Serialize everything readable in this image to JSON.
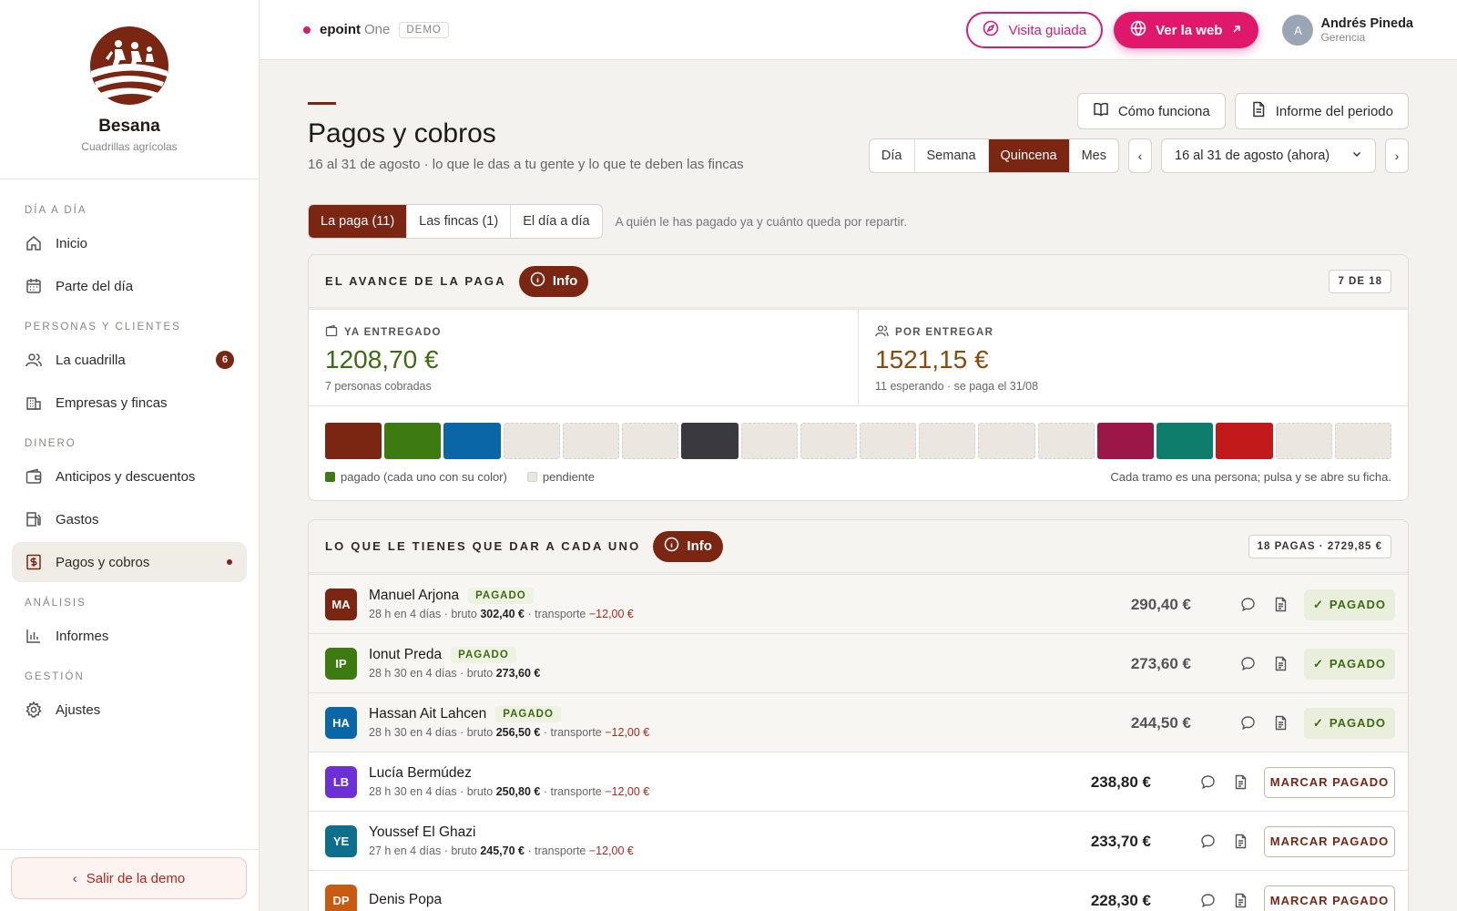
{
  "sidebar": {
    "brand_name": "Besana",
    "brand_sub": "Cuadrillas agrícolas",
    "sections": [
      {
        "title": "DÍA A DÍA"
      },
      {
        "title": "PERSONAS Y CLIENTES"
      },
      {
        "title": "DINERO"
      },
      {
        "title": "ANÁLISIS"
      },
      {
        "title": "GESTIÓN"
      }
    ],
    "items": {
      "inicio": "Inicio",
      "parte": "Parte del día",
      "cuadrilla": "La cuadrilla",
      "cuadrilla_badge": "6",
      "empresas": "Empresas y fincas",
      "anticipos": "Anticipos y descuentos",
      "gastos": "Gastos",
      "pagos": "Pagos y cobros",
      "informes": "Informes",
      "ajustes": "Ajustes"
    },
    "exit_label": "Salir de la demo"
  },
  "topbar": {
    "app_name": "epoint",
    "app_suffix": "One",
    "demo_tag": "DEMO",
    "guided_tour": "Visita guiada",
    "view_web": "Ver la web",
    "user_initial": "A",
    "user_name": "Andrés Pineda",
    "user_role": "Gerencia"
  },
  "header": {
    "title": "Pagos y cobros",
    "subtitle": "16 al 31 de agosto · lo que le das a tu gente y lo que te deben las fincas",
    "how_it_works": "Cómo funciona",
    "period_report": "Informe del periodo",
    "period_options": [
      "Día",
      "Semana",
      "Quincena",
      "Mes"
    ],
    "period_selected": "Quincena",
    "period_value": "16 al 31 de agosto (ahora)"
  },
  "tabs": {
    "items": [
      "La paga (11)",
      "Las fincas (1)",
      "El día a día"
    ],
    "active": "La paga (11)",
    "hint": "A quién le has pagado ya y cuánto queda por repartir."
  },
  "progress_card": {
    "title": "EL AVANCE DE LA PAGA",
    "info": "Info",
    "tag": "7 DE 18",
    "delivered_label": "YA ENTREGADO",
    "delivered_value": "1208,70 €",
    "delivered_note": "7 personas cobradas",
    "pending_label": "POR ENTREGAR",
    "pending_value": "1521,15 €",
    "pending_note": "11 esperando · se paga el 31/08",
    "segments": [
      "#7a2613",
      "#3d7a12",
      "#0b66a8",
      "pend",
      "pend",
      "pend",
      "#3a3940",
      "pend",
      "pend",
      "pend",
      "pend",
      "pend",
      "pend",
      "#9c1648",
      "#0f7d6c",
      "#c21a1a",
      "pend",
      "pend"
    ],
    "legend_paid": "pagado (cada uno con su color)",
    "legend_pending": "pendiente",
    "legend_hint": "Cada tramo es una persona; pulsa y se abre su ficha."
  },
  "pay_card": {
    "title": "LO QUE LE TIENES QUE DAR A CADA UNO",
    "info": "Info",
    "tag": "18 PAGAS · 2729,85 €",
    "paid_label": "PAGADO",
    "mark_label": "MARCAR PAGADO",
    "rows": [
      {
        "initials": "MA",
        "color": "#7a2613",
        "name": "Manuel Arjona",
        "paid": true,
        "hours": "28 h en 4 días · bruto ",
        "gross": "302,40 €",
        "transport_label": " · transporte ",
        "transport": "−12,00 €",
        "amount": "290,40 €"
      },
      {
        "initials": "IP",
        "color": "#3d7a12",
        "name": "Ionut Preda",
        "paid": true,
        "hours": "28 h 30 en 4 días · bruto ",
        "gross": "273,60 €",
        "transport_label": "",
        "transport": "",
        "amount": "273,60 €"
      },
      {
        "initials": "HA",
        "color": "#0b66a8",
        "name": "Hassan Ait Lahcen",
        "paid": true,
        "hours": "28 h 30 en 4 días · bruto ",
        "gross": "256,50 €",
        "transport_label": " · transporte ",
        "transport": "−12,00 €",
        "amount": "244,50 €"
      },
      {
        "initials": "LB",
        "color": "#6d2fd6",
        "name": "Lucía Bermúdez",
        "paid": false,
        "hours": "28 h 30 en 4 días · bruto ",
        "gross": "250,80 €",
        "transport_label": " · transporte ",
        "transport": "−12,00 €",
        "amount": "238,80 €"
      },
      {
        "initials": "YE",
        "color": "#0e6f8c",
        "name": "Youssef El Ghazi",
        "paid": false,
        "hours": "27 h en 4 días · bruto ",
        "gross": "245,70 €",
        "transport_label": " · transporte ",
        "transport": "−12,00 €",
        "amount": "233,70 €"
      },
      {
        "initials": "DP",
        "color": "#c85a12",
        "name": "Denis Popa",
        "paid": false,
        "hours": "",
        "gross": "",
        "transport_label": "",
        "transport": "",
        "amount": "228,30 €"
      }
    ]
  }
}
